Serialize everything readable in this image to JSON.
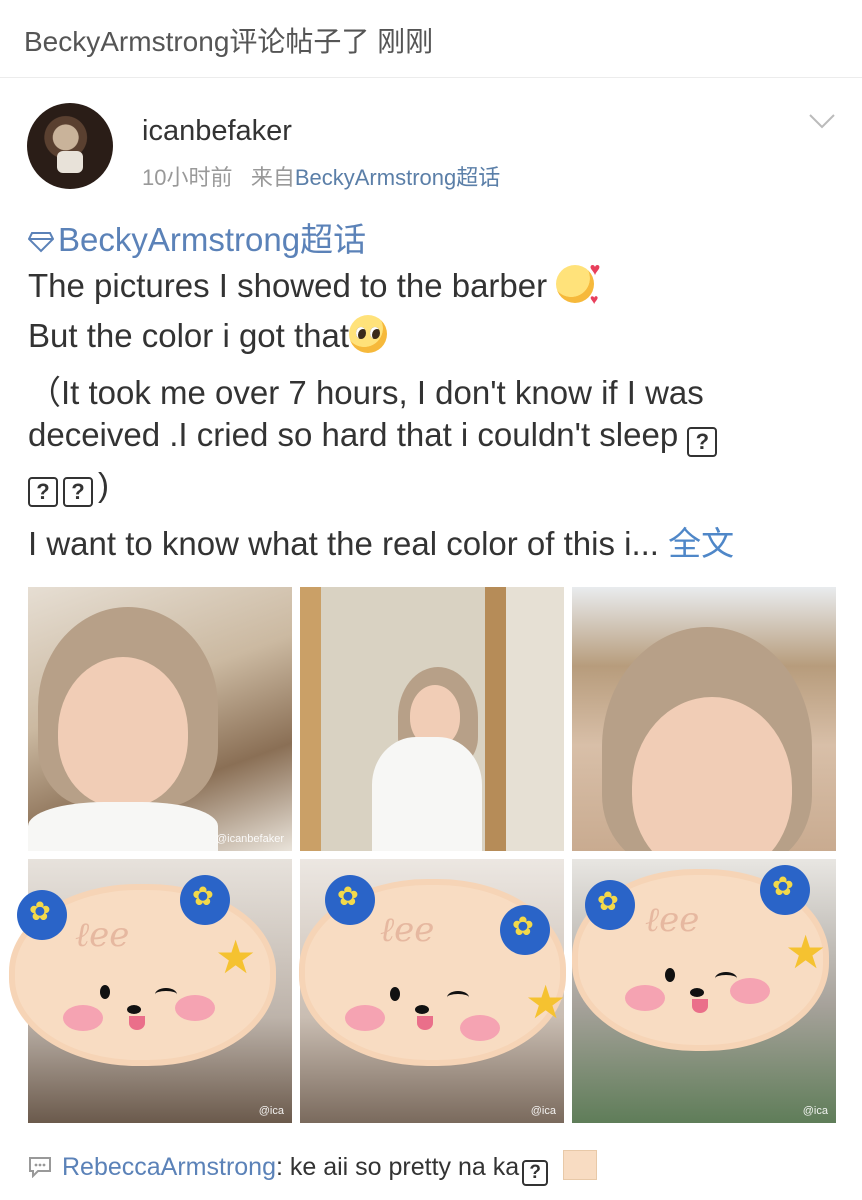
{
  "header": {
    "text": "BeckyArmstrong评论帖子了 刚刚"
  },
  "post": {
    "username": "icanbefaker",
    "time": "10小时前",
    "source_prefix": "来自",
    "source": "BeckyArmstrong超话",
    "topic": "BeckyArmstrong超话",
    "lines": {
      "l1": "The pictures I showed to the barber ",
      "l2": "But the color i got that",
      "l3": "（It took me over 7 hours, I don't know if I was",
      "l4": "deceived .I cried so hard that i couldn't sleep ",
      "l5": ")",
      "l6": "I want to know what the real color of this i... ",
      "full_link": "全文"
    },
    "photos": [
      {
        "watermark": "@icanbefaker"
      },
      {
        "watermark": ""
      },
      {
        "watermark": ""
      },
      {
        "watermark": "@ica"
      },
      {
        "watermark": "@ica"
      },
      {
        "watermark": "@ica"
      }
    ]
  },
  "comment": {
    "user": "RebeccaArmstrong",
    "text": ": ke aii so pretty na ka"
  },
  "icons": {
    "topic": "diamond-icon",
    "menu": "chevron-down-icon",
    "comment": "comment-bubble-icon"
  },
  "colors": {
    "link": "#5b82b8",
    "full_link": "#4f87c8",
    "meta": "#999999"
  }
}
